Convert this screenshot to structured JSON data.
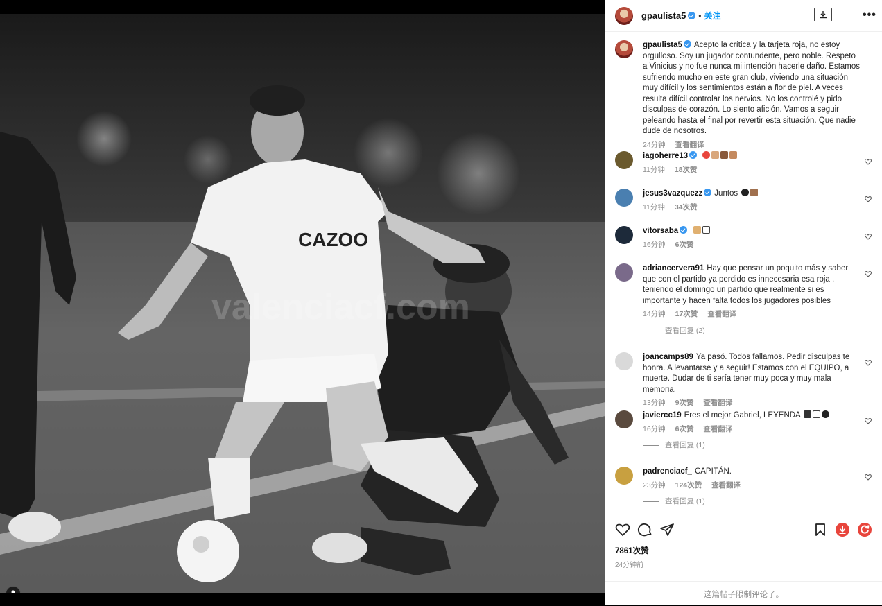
{
  "post": {
    "username": "gpaulista5",
    "follow_label": "关注",
    "header_sep": "•",
    "caption": "Acepto la crítica y la tarjeta roja, no estoy orgulloso. Soy un jugador contundente, pero noble. Respeto a Vinicius y no fue nunca mi intención hacerle daño. Estamos sufriendo mucho en este gran club, viviendo una situación muy difícil y los sentimientos están a flor de piel. A veces resulta difícil controlar los nervios. No los controlé y pido disculpas de corazón. Lo siento afición. Vamos a seguir peleando hasta el final por revertir esta situación. Que nadie dude de nosotros.",
    "caption_time": "24分钟",
    "translate_label": "查看翻译",
    "likes": "7861次赞",
    "posted_ago": "24分钟前",
    "comments_limited": "这篇帖子限制评论了。",
    "media_watermark": "valenciacf.com"
  },
  "comments": [
    {
      "username": "iagoherre13",
      "verified": true,
      "text": "",
      "emoji": [
        "heart-red",
        "muscle",
        "handshake-l",
        "handshake-r"
      ],
      "time": "11分钟",
      "likes": "18次赞",
      "translate": "",
      "replies": "",
      "avatar_color": "#6b5a2e"
    },
    {
      "username": "jesus3vazquezz",
      "verified": true,
      "text": "Juntos",
      "emoji": [
        "heart-black",
        "muscle"
      ],
      "time": "11分钟",
      "likes": "34次赞",
      "translate": "",
      "replies": "",
      "avatar_color": "#4a7fb0"
    },
    {
      "username": "vitorsaba",
      "verified": true,
      "text": "",
      "emoji": [
        "pray",
        "box"
      ],
      "time": "16分钟",
      "likes": "6次赞",
      "translate": "",
      "replies": "",
      "avatar_color": "#1d2a3a"
    },
    {
      "username": "adriancervera91",
      "verified": false,
      "text": "Hay que pensar un poquito más y saber que con el partido ya perdido es innecesaria esa roja , teniendo el domingo un partido que realmente si es importante y hacen falta todos los jugadores posibles",
      "emoji": [],
      "time": "14分钟",
      "likes": "17次赞",
      "translate": "查看翻译",
      "replies": "查看回复 (2)",
      "avatar_color": "#7a6a8a"
    },
    {
      "username": "joancamps89",
      "verified": false,
      "text": "Ya pasó. Todos fallamos. Pedir disculpas te honra. A levantarse y a seguir! Estamos con el EQUIPO, a muerte. Dudar de ti sería tener muy poca y muy mala memoria.",
      "emoji": [],
      "time": "13分钟",
      "likes": "9次赞",
      "translate": "查看翻译",
      "replies": "",
      "avatar_color": "#d9d9d9"
    },
    {
      "username": "javiercc19",
      "verified": false,
      "text": "Eres el mejor Gabriel, LEYENDA",
      "emoji": [
        "bat",
        "box",
        "heart-black"
      ],
      "time": "16分钟",
      "likes": "6次赞",
      "translate": "查看翻译",
      "replies": "查看回复 (1)",
      "avatar_color": "#5a4a3e"
    },
    {
      "username": "padrenciacf_",
      "verified": false,
      "text": "CAPITÁN.",
      "emoji": [],
      "time": "23分钟",
      "likes": "124次赞",
      "translate": "查看翻译",
      "replies": "查看回复 (1)",
      "avatar_color": "#c8a040"
    }
  ],
  "icons": {
    "like": "heart-outline-icon",
    "comment": "comment-bubble-icon",
    "share": "paper-plane-icon",
    "save": "bookmark-icon",
    "download_ext": "download-circle-icon",
    "refresh_ext": "refresh-circle-icon",
    "accent_red": "#e8453c",
    "link_blue": "#0095f6"
  }
}
